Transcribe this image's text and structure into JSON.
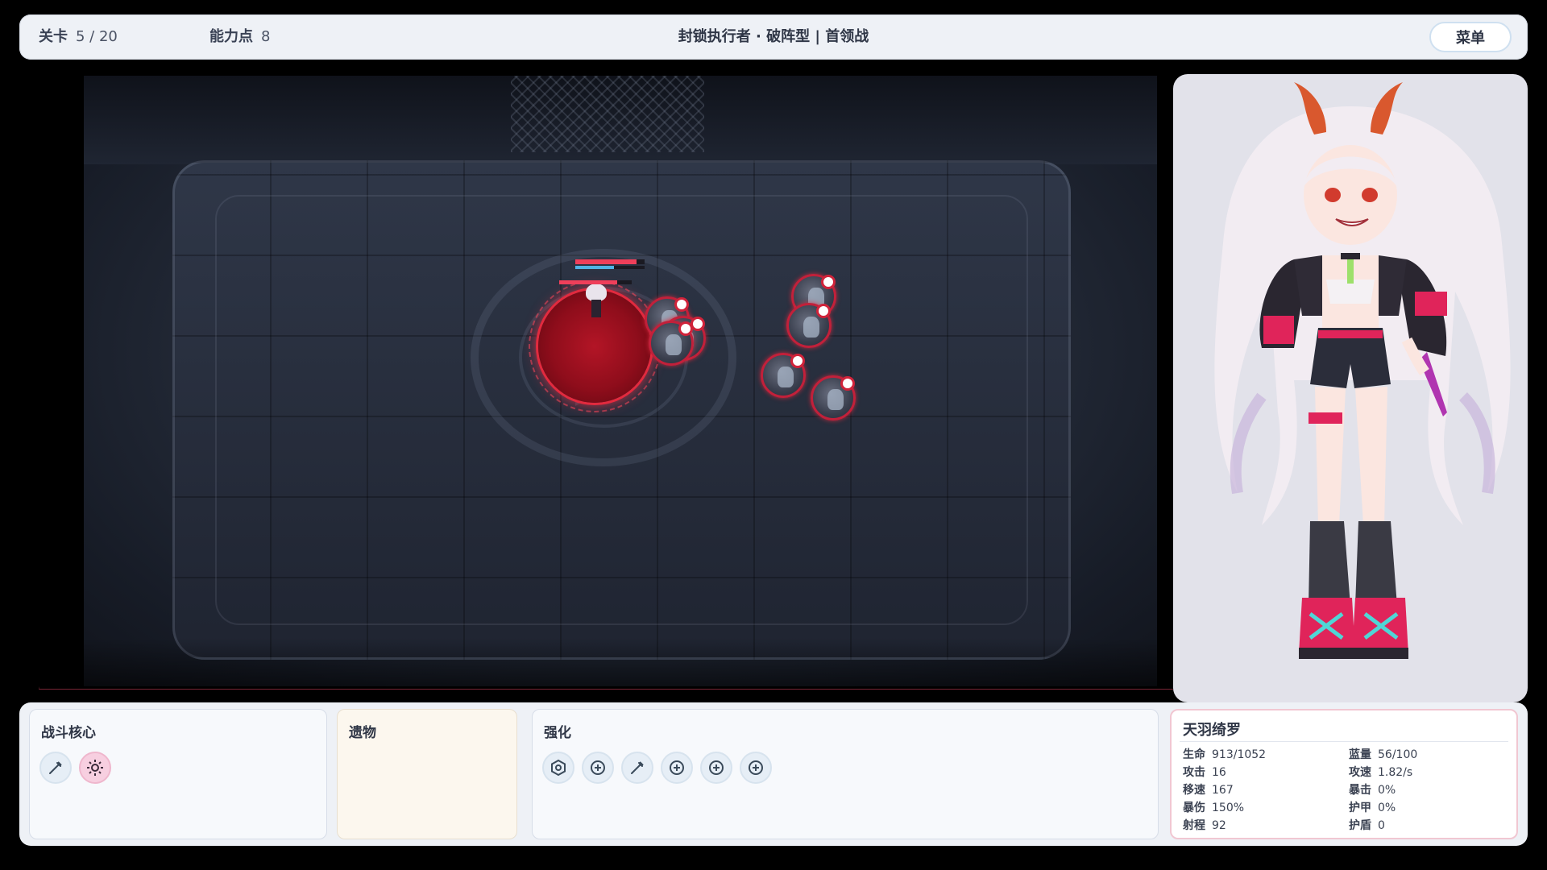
{
  "topbar": {
    "level_label": "关卡",
    "level_value": "5 / 20",
    "points_label": "能力点",
    "points_value": "8",
    "title": "封锁执行者 · 破阵型 | 首领战",
    "menu_label": "菜单"
  },
  "arena": {
    "player": {
      "hp_fraction": 0.88,
      "mana_fraction": 0.56
    },
    "enemies_count": 6
  },
  "panels": {
    "core": {
      "title": "战斗核心",
      "icons": [
        "sword-icon",
        "sun-icon"
      ]
    },
    "relic": {
      "title": "遗物"
    },
    "boost": {
      "title": "强化",
      "icons": [
        "hexagon-icon",
        "plus-circle-icon",
        "sword-icon",
        "plus-circle-icon",
        "plus-circle-icon",
        "plus-circle-icon"
      ]
    },
    "stats": {
      "name": "天羽绮罗",
      "left": [
        {
          "label": "生命",
          "value": "913/1052"
        },
        {
          "label": "攻击",
          "value": "16"
        },
        {
          "label": "移速",
          "value": "167"
        },
        {
          "label": "暴伤",
          "value": "150%"
        },
        {
          "label": "射程",
          "value": "92"
        }
      ],
      "right": [
        {
          "label": "蓝量",
          "value": "56/100"
        },
        {
          "label": "攻速",
          "value": "1.82/s"
        },
        {
          "label": "暴击",
          "value": "0%"
        },
        {
          "label": "护甲",
          "value": "0%"
        },
        {
          "label": "护盾",
          "value": "0"
        }
      ]
    }
  },
  "colors": {
    "accent_red": "#e22a3e",
    "panel_bg": "#eef1f6",
    "pink_icon": "#f7cfe0"
  }
}
